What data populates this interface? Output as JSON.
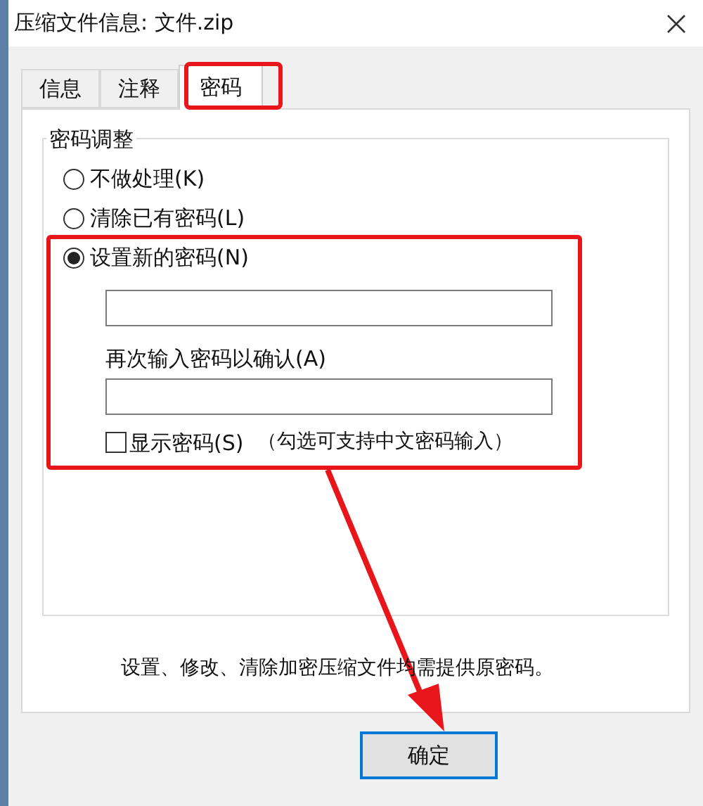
{
  "window": {
    "title": "压缩文件信息: 文件.zip"
  },
  "tabs": [
    {
      "label": "信息",
      "selected": false
    },
    {
      "label": "注释",
      "selected": false
    },
    {
      "label": "密码",
      "selected": true
    }
  ],
  "group": {
    "title": "密码调整",
    "options": [
      {
        "label": "不做处理(K)",
        "selected": false
      },
      {
        "label": "清除已有密码(L)",
        "selected": false
      },
      {
        "label": "设置新的密码(N)",
        "selected": true
      }
    ],
    "confirm_label": "再次输入密码以确认(A)",
    "show_password": {
      "label": "显示密码(S)",
      "checked": false
    },
    "hint": "（勾选可支持中文密码输入）"
  },
  "note": "设置、修改、清除加密压缩文件均需提供原密码。",
  "buttons": [
    "确定"
  ]
}
